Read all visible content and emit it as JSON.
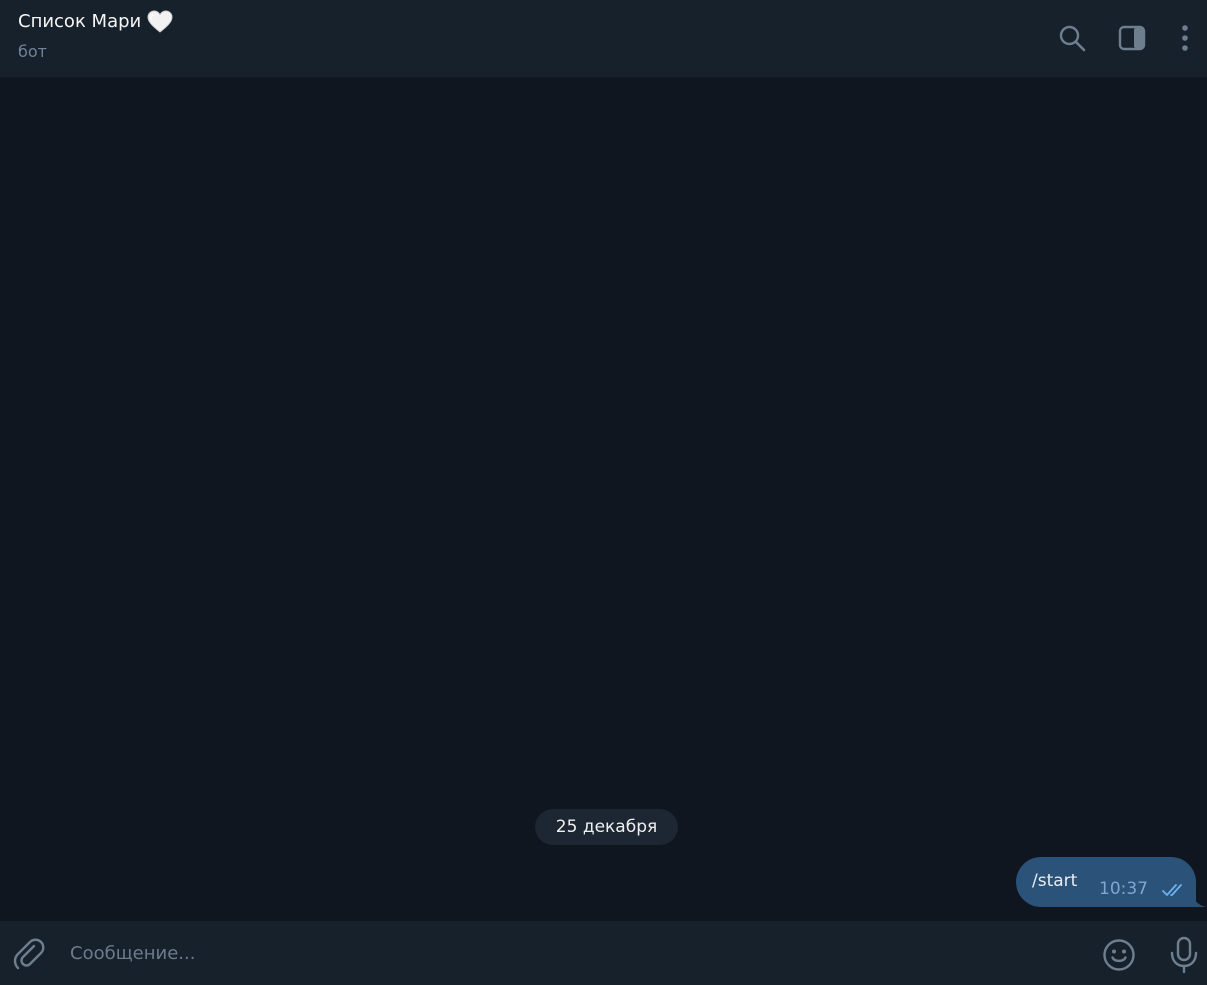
{
  "header": {
    "title": "Список Мари",
    "title_emoji_icon": "white-heart-icon",
    "subtitle": "бот",
    "actions": [
      {
        "icon": "search-icon"
      },
      {
        "icon": "sidebar-toggle-icon"
      },
      {
        "icon": "more-vertical-icon"
      }
    ]
  },
  "messages": {
    "date_separator": "25 декабря",
    "items": [
      {
        "text": "/start",
        "time": "10:37",
        "outgoing": true,
        "status_icon": "double-check-icon"
      }
    ]
  },
  "composer": {
    "placeholder": "Сообщение...",
    "value": "",
    "attach_icon": "paperclip-icon",
    "emoji_icon": "smiley-icon",
    "mic_icon": "microphone-icon"
  },
  "colors": {
    "header_bg": "#17212b",
    "chat_bg": "#0f1620",
    "bubble_out": "#2b5278",
    "accent_time": "#7da8d3",
    "subtitle": "#708499",
    "icon": "#6d7f8f"
  }
}
